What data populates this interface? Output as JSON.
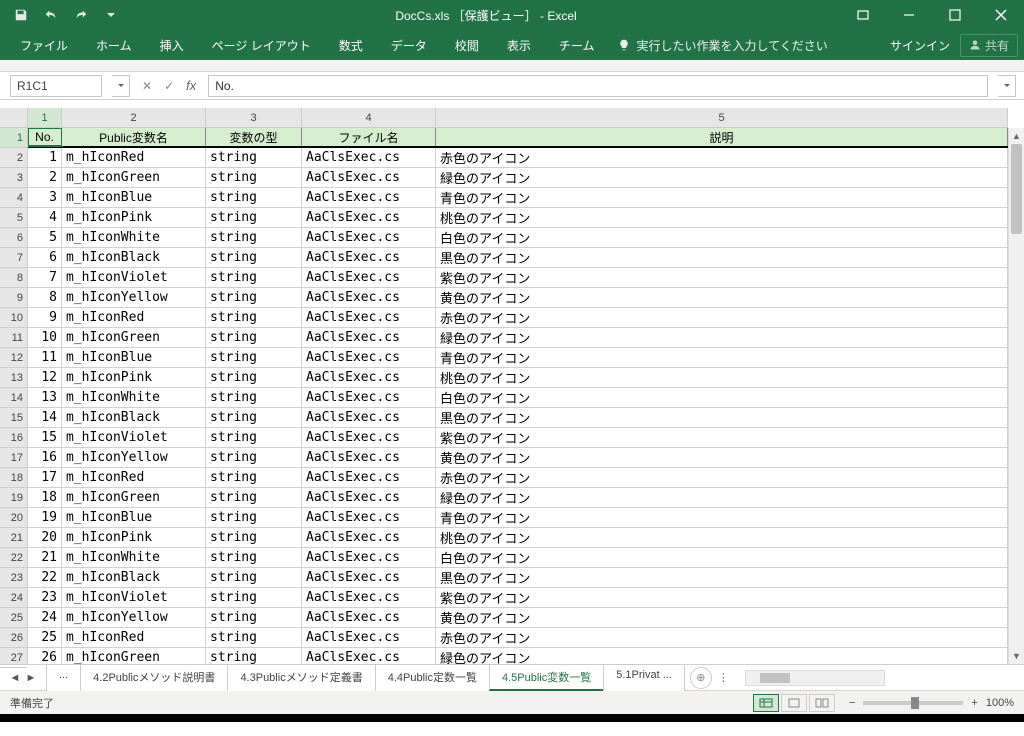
{
  "title": "DocCs.xls ［保護ビュー］ - Excel",
  "ribbon_tabs": [
    "ファイル",
    "ホーム",
    "挿入",
    "ページ レイアウト",
    "数式",
    "データ",
    "校閲",
    "表示",
    "チーム"
  ],
  "tell_me": "実行したい作業を入力してください",
  "signin": "サインイン",
  "share": "共有",
  "name_box": "R1C1",
  "formula": "No.",
  "col_numbers": [
    "1",
    "2",
    "3",
    "4",
    "5"
  ],
  "row_numbers": [
    "1",
    "2",
    "3",
    "4",
    "5",
    "6",
    "7",
    "8",
    "9",
    "10",
    "11",
    "12",
    "13",
    "14",
    "15",
    "16",
    "17",
    "18",
    "19",
    "20",
    "21",
    "22",
    "23",
    "24",
    "25",
    "26",
    "27"
  ],
  "headers": {
    "no": "No.",
    "name": "Public変数名",
    "type": "変数の型",
    "file": "ファイル名",
    "desc": "説明"
  },
  "rows": [
    {
      "no": "1",
      "name": "m_hIconRed",
      "type": "string",
      "file": "AaClsExec.cs",
      "desc": "赤色のアイコン"
    },
    {
      "no": "2",
      "name": "m_hIconGreen",
      "type": "string",
      "file": "AaClsExec.cs",
      "desc": "緑色のアイコン"
    },
    {
      "no": "3",
      "name": "m_hIconBlue",
      "type": "string",
      "file": "AaClsExec.cs",
      "desc": "青色のアイコン"
    },
    {
      "no": "4",
      "name": "m_hIconPink",
      "type": "string",
      "file": "AaClsExec.cs",
      "desc": "桃色のアイコン"
    },
    {
      "no": "5",
      "name": "m_hIconWhite",
      "type": "string",
      "file": "AaClsExec.cs",
      "desc": "白色のアイコン"
    },
    {
      "no": "6",
      "name": "m_hIconBlack",
      "type": "string",
      "file": "AaClsExec.cs",
      "desc": "黒色のアイコン"
    },
    {
      "no": "7",
      "name": "m_hIconViolet",
      "type": "string",
      "file": "AaClsExec.cs",
      "desc": "紫色のアイコン"
    },
    {
      "no": "8",
      "name": "m_hIconYellow",
      "type": "string",
      "file": "AaClsExec.cs",
      "desc": "黄色のアイコン"
    },
    {
      "no": "9",
      "name": "m_hIconRed",
      "type": "string",
      "file": "AaClsExec.cs",
      "desc": "赤色のアイコン"
    },
    {
      "no": "10",
      "name": "m_hIconGreen",
      "type": "string",
      "file": "AaClsExec.cs",
      "desc": "緑色のアイコン"
    },
    {
      "no": "11",
      "name": "m_hIconBlue",
      "type": "string",
      "file": "AaClsExec.cs",
      "desc": "青色のアイコン"
    },
    {
      "no": "12",
      "name": "m_hIconPink",
      "type": "string",
      "file": "AaClsExec.cs",
      "desc": "桃色のアイコン"
    },
    {
      "no": "13",
      "name": "m_hIconWhite",
      "type": "string",
      "file": "AaClsExec.cs",
      "desc": "白色のアイコン"
    },
    {
      "no": "14",
      "name": "m_hIconBlack",
      "type": "string",
      "file": "AaClsExec.cs",
      "desc": "黒色のアイコン"
    },
    {
      "no": "15",
      "name": "m_hIconViolet",
      "type": "string",
      "file": "AaClsExec.cs",
      "desc": "紫色のアイコン"
    },
    {
      "no": "16",
      "name": "m_hIconYellow",
      "type": "string",
      "file": "AaClsExec.cs",
      "desc": "黄色のアイコン"
    },
    {
      "no": "17",
      "name": "m_hIconRed",
      "type": "string",
      "file": "AaClsExec.cs",
      "desc": "赤色のアイコン"
    },
    {
      "no": "18",
      "name": "m_hIconGreen",
      "type": "string",
      "file": "AaClsExec.cs",
      "desc": "緑色のアイコン"
    },
    {
      "no": "19",
      "name": "m_hIconBlue",
      "type": "string",
      "file": "AaClsExec.cs",
      "desc": "青色のアイコン"
    },
    {
      "no": "20",
      "name": "m_hIconPink",
      "type": "string",
      "file": "AaClsExec.cs",
      "desc": "桃色のアイコン"
    },
    {
      "no": "21",
      "name": "m_hIconWhite",
      "type": "string",
      "file": "AaClsExec.cs",
      "desc": "白色のアイコン"
    },
    {
      "no": "22",
      "name": "m_hIconBlack",
      "type": "string",
      "file": "AaClsExec.cs",
      "desc": "黒色のアイコン"
    },
    {
      "no": "23",
      "name": "m_hIconViolet",
      "type": "string",
      "file": "AaClsExec.cs",
      "desc": "紫色のアイコン"
    },
    {
      "no": "24",
      "name": "m_hIconYellow",
      "type": "string",
      "file": "AaClsExec.cs",
      "desc": "黄色のアイコン"
    },
    {
      "no": "25",
      "name": "m_hIconRed",
      "type": "string",
      "file": "AaClsExec.cs",
      "desc": "赤色のアイコン"
    },
    {
      "no": "26",
      "name": "m_hIconGreen",
      "type": "string",
      "file": "AaClsExec.cs",
      "desc": "緑色のアイコン"
    }
  ],
  "sheet_tabs": [
    {
      "label": "...",
      "active": false
    },
    {
      "label": "4.2Publicメソッド説明書",
      "active": false
    },
    {
      "label": "4.3Publicメソッド定義書",
      "active": false
    },
    {
      "label": "4.4Public定数一覧",
      "active": false
    },
    {
      "label": "4.5Public変数一覧",
      "active": true
    },
    {
      "label": "5.1Privat ...",
      "active": false
    }
  ],
  "status": "準備完了",
  "zoom": "100%"
}
